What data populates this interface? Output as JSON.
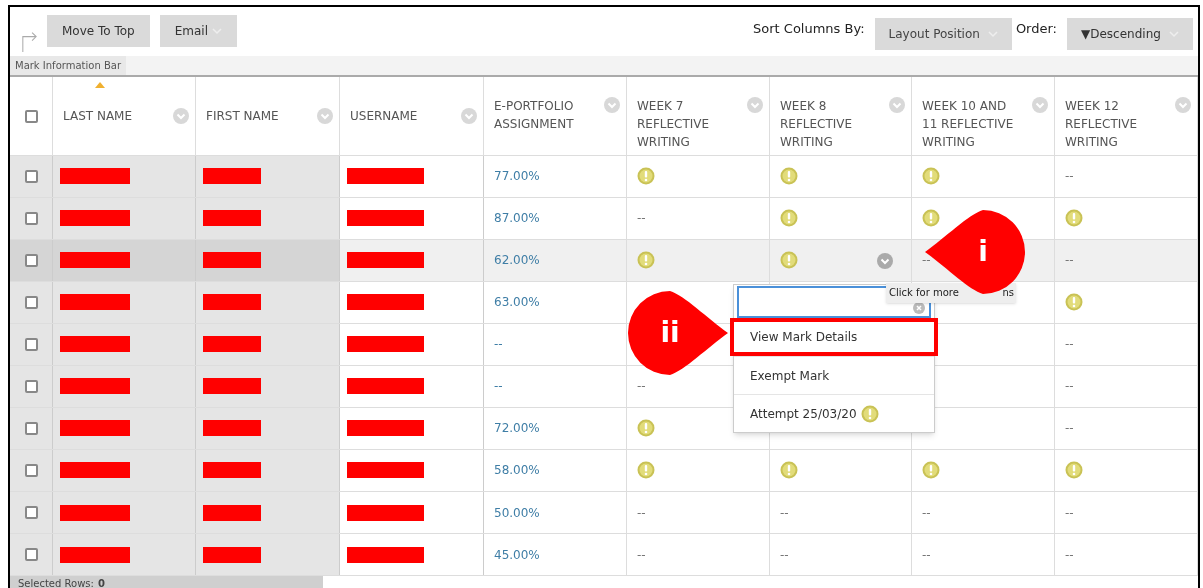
{
  "toolbar": {
    "buttons": [
      {
        "label": "Move To Top",
        "dropdown": false
      },
      {
        "label": "Email",
        "dropdown": true
      }
    ],
    "sort_label": "Sort Columns By:",
    "sort_value": "Layout Position",
    "order_label": "Order:",
    "order_value": "▼Descending"
  },
  "info_bar": "Mark Information Bar",
  "table": {
    "select_all": {
      "checked": false
    },
    "columns": [
      {
        "label": "LAST NAME",
        "kind": "redacted",
        "sorted": true
      },
      {
        "label": "FIRST NAME",
        "kind": "redacted",
        "sorted": false
      },
      {
        "label": "USERNAME",
        "kind": "redacted",
        "sorted": false
      },
      {
        "label": "E-PORTFOLIO ASSIGNMENT",
        "kind": "grade",
        "sorted": false
      },
      {
        "label": "WEEK 7 REFLECTIVE WRITING",
        "kind": "grade",
        "sorted": false
      },
      {
        "label": "WEEK 8 REFLECTIVE WRITING",
        "kind": "grade",
        "sorted": false
      },
      {
        "label": "WEEK 10 AND 11 REFLECTIVE WRITING",
        "kind": "grade",
        "sorted": false
      },
      {
        "label": "WEEK 12 REFLECTIVE WRITING",
        "kind": "grade",
        "sorted": false
      }
    ],
    "rows": [
      {
        "checked": false,
        "highlighted": false,
        "cells": [
          {
            "kind": "redacted"
          },
          {
            "kind": "redacted"
          },
          {
            "kind": "redacted"
          },
          {
            "kind": "link",
            "text": "77.00%"
          },
          {
            "kind": "icon"
          },
          {
            "kind": "icon"
          },
          {
            "kind": "icon"
          },
          {
            "kind": "text",
            "text": "--"
          }
        ]
      },
      {
        "checked": false,
        "highlighted": false,
        "cells": [
          {
            "kind": "redacted"
          },
          {
            "kind": "redacted"
          },
          {
            "kind": "redacted"
          },
          {
            "kind": "link",
            "text": "87.00%"
          },
          {
            "kind": "text",
            "text": "--"
          },
          {
            "kind": "icon"
          },
          {
            "kind": "icon"
          },
          {
            "kind": "icon"
          }
        ]
      },
      {
        "checked": false,
        "highlighted": true,
        "cells": [
          {
            "kind": "redacted"
          },
          {
            "kind": "redacted"
          },
          {
            "kind": "redacted"
          },
          {
            "kind": "link",
            "text": "62.00%"
          },
          {
            "kind": "icon"
          },
          {
            "kind": "icon",
            "menu_button": true
          },
          {
            "kind": "text",
            "text": "--"
          },
          {
            "kind": "text",
            "text": "--"
          }
        ]
      },
      {
        "checked": false,
        "highlighted": false,
        "cells": [
          {
            "kind": "redacted"
          },
          {
            "kind": "redacted"
          },
          {
            "kind": "redacted"
          },
          {
            "kind": "link",
            "text": "63.00%"
          },
          {
            "kind": "empty"
          },
          {
            "kind": "empty"
          },
          {
            "kind": "empty"
          },
          {
            "kind": "icon"
          }
        ]
      },
      {
        "checked": false,
        "highlighted": false,
        "cells": [
          {
            "kind": "redacted"
          },
          {
            "kind": "redacted"
          },
          {
            "kind": "redacted"
          },
          {
            "kind": "link",
            "text": "--"
          },
          {
            "kind": "empty"
          },
          {
            "kind": "empty"
          },
          {
            "kind": "empty"
          },
          {
            "kind": "text",
            "text": "--"
          }
        ]
      },
      {
        "checked": false,
        "highlighted": false,
        "cells": [
          {
            "kind": "redacted"
          },
          {
            "kind": "redacted"
          },
          {
            "kind": "redacted"
          },
          {
            "kind": "link",
            "text": "--"
          },
          {
            "kind": "text",
            "text": "--"
          },
          {
            "kind": "empty"
          },
          {
            "kind": "empty"
          },
          {
            "kind": "text",
            "text": "--"
          }
        ]
      },
      {
        "checked": false,
        "highlighted": false,
        "cells": [
          {
            "kind": "redacted"
          },
          {
            "kind": "redacted"
          },
          {
            "kind": "redacted"
          },
          {
            "kind": "link",
            "text": "72.00%"
          },
          {
            "kind": "icon"
          },
          {
            "kind": "empty"
          },
          {
            "kind": "empty"
          },
          {
            "kind": "text",
            "text": "--"
          }
        ]
      },
      {
        "checked": false,
        "highlighted": false,
        "cells": [
          {
            "kind": "redacted"
          },
          {
            "kind": "redacted"
          },
          {
            "kind": "redacted"
          },
          {
            "kind": "link",
            "text": "58.00%"
          },
          {
            "kind": "icon"
          },
          {
            "kind": "icon"
          },
          {
            "kind": "icon"
          },
          {
            "kind": "icon"
          }
        ]
      },
      {
        "checked": false,
        "highlighted": false,
        "cells": [
          {
            "kind": "redacted"
          },
          {
            "kind": "redacted"
          },
          {
            "kind": "redacted"
          },
          {
            "kind": "link",
            "text": "50.00%"
          },
          {
            "kind": "text",
            "text": "--"
          },
          {
            "kind": "text",
            "text": "--"
          },
          {
            "kind": "text",
            "text": "--"
          },
          {
            "kind": "text",
            "text": "--"
          }
        ]
      },
      {
        "checked": false,
        "highlighted": false,
        "cells": [
          {
            "kind": "redacted"
          },
          {
            "kind": "redacted"
          },
          {
            "kind": "redacted"
          },
          {
            "kind": "link",
            "text": "45.00%"
          },
          {
            "kind": "text",
            "text": "--"
          },
          {
            "kind": "text",
            "text": "--"
          },
          {
            "kind": "text",
            "text": "--"
          },
          {
            "kind": "text",
            "text": "--"
          }
        ]
      }
    ]
  },
  "menu": {
    "items": [
      {
        "label": "View Mark Details",
        "outlined": true,
        "icon": false
      },
      {
        "label": "Exempt Mark",
        "outlined": false,
        "icon": false
      },
      {
        "label": "Attempt 25/03/20",
        "outlined": false,
        "icon": true
      }
    ]
  },
  "tooltip": {
    "start": "Click for more",
    "end": "ns"
  },
  "callouts": [
    {
      "label": "i",
      "kind": "left"
    },
    {
      "label": "ii",
      "kind": "right"
    }
  ],
  "status": {
    "label": "Selected Rows:",
    "count": "0"
  }
}
